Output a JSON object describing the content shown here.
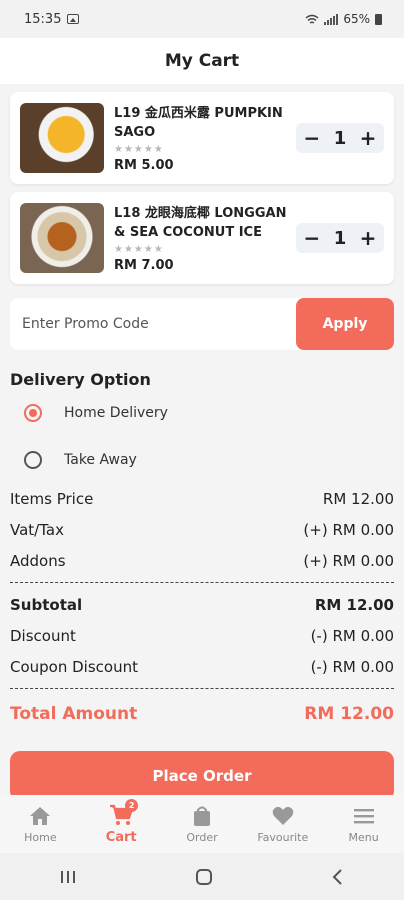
{
  "status_bar": {
    "time": "15:35",
    "battery": "65%"
  },
  "header": {
    "title": "My Cart"
  },
  "cart": {
    "items": [
      {
        "name": "L19 金瓜西米露 PUMPKIN SAGO",
        "stars": "★★★★★",
        "price": "RM 5.00",
        "quantity": "1",
        "image_icon": "pumpkin-sago-photo"
      },
      {
        "name": "L18 龙眼海底椰 LONGGAN & SEA COCONUT ICE",
        "stars": "★★★★★",
        "price": "RM 7.00",
        "quantity": "1",
        "image_icon": "longgan-ice-photo"
      }
    ],
    "stepper": {
      "minus": "−",
      "plus": "+"
    }
  },
  "promo": {
    "placeholder": "Enter Promo Code",
    "value": "",
    "apply_label": "Apply"
  },
  "delivery": {
    "title": "Delivery Option",
    "options": [
      {
        "label": "Home Delivery",
        "selected": true
      },
      {
        "label": "Take Away",
        "selected": false
      }
    ]
  },
  "summary": {
    "items_price": {
      "label": "Items Price",
      "value": "RM 12.00"
    },
    "vat": {
      "label": "Vat/Tax",
      "value": "(+) RM 0.00"
    },
    "addons": {
      "label": "Addons",
      "value": "(+) RM 0.00"
    },
    "subtotal": {
      "label": "Subtotal",
      "value": "RM 12.00"
    },
    "discount": {
      "label": "Discount",
      "value": "(-) RM 0.00"
    },
    "coupon_discount": {
      "label": "Coupon Discount",
      "value": "(-) RM 0.00"
    },
    "total": {
      "label": "Total Amount",
      "value": "RM 12.00"
    }
  },
  "place_order": {
    "label": "Place Order"
  },
  "bottom_nav": {
    "items": [
      {
        "label": "Home",
        "icon": "home-icon"
      },
      {
        "label": "Cart",
        "icon": "cart-icon",
        "badge": "2",
        "active": true
      },
      {
        "label": "Order",
        "icon": "bag-icon"
      },
      {
        "label": "Favourite",
        "icon": "heart-icon"
      },
      {
        "label": "Menu",
        "icon": "menu-icon"
      }
    ]
  },
  "colors": {
    "accent": "#f36c5b",
    "background": "#f4f4f4",
    "card": "#ffffff",
    "stepper_bg": "#eef2f7"
  }
}
